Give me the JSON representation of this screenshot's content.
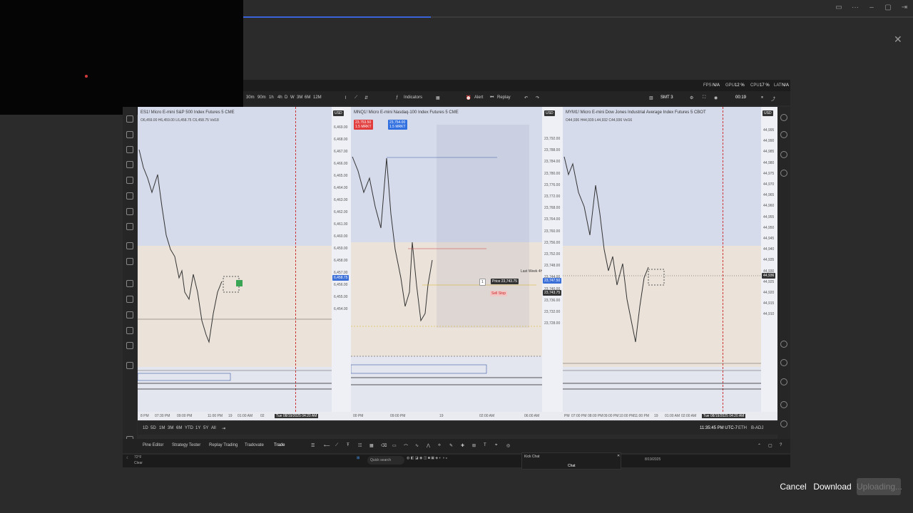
{
  "window": {
    "progress_percent": 28
  },
  "header": {
    "close_icon": "close-icon"
  },
  "status": {
    "fps": "FPS",
    "fps_val": "N/A",
    "gpu": "GPU",
    "gpu_val": "12 %",
    "cpu": "CPU",
    "cpu_val": "17 %",
    "lat": "LAT",
    "lat_val": "N/A"
  },
  "timeframes": [
    "30m",
    "90m",
    "1h",
    "4h",
    "D",
    "W",
    "3M",
    "6M",
    "12M"
  ],
  "toolbar": {
    "indicators": "Indicators",
    "alert": "Alert",
    "replay": "Replay",
    "layout_name": "SMT 3",
    "layout_sub": "Save",
    "timer": "00:19"
  },
  "panes": [
    {
      "title": "ES1!  Micro E-mini S&P 500 Index Futures  5  CME",
      "ohlc": "O6,459.00 H6,459.00 L6,458.75 C6,458.75 Vol18",
      "currency": "USD",
      "ticks": [
        "6,469.00",
        "6,468.00",
        "6,467.00",
        "6,466.00",
        "6,465.00",
        "6,464.00",
        "6,463.00",
        "6,462.00",
        "6,461.00",
        "6,460.00",
        "6,459.00",
        "6,458.00",
        "6,457.00",
        "6,456.00",
        "6,455.00",
        "6,454.00"
      ],
      "last_price": "6,458.75",
      "time_labels": [
        "8 PM",
        "07:30 PM",
        "09:00 PM",
        "11:00 PM",
        "19",
        "01:00 AM",
        "02"
      ],
      "cursor_time": "Tue 08/19/2025  04:20 AM"
    },
    {
      "title": "MNQ1!  Micro E-mini Nasdaq-100 Index Futures  5  CME",
      "ohlc": "",
      "currency": "USD",
      "sell_price": "23,753.50",
      "sell_label": "1.5 MRKT",
      "buy_price": "23,754.00",
      "buy_label": "1.5 MRKT",
      "ticks": [
        "23,792.00",
        "23,788.00",
        "23,784.00",
        "23,780.00",
        "23,776.00",
        "23,772.00",
        "23,768.00",
        "23,764.00",
        "23,760.00",
        "23,756.00",
        "23,752.00",
        "23,748.00",
        "23,744.00",
        "23,740.00",
        "23,736.00",
        "23,732.00",
        "23,728.00"
      ],
      "last_price": "23,747.50",
      "order_price": "Price 23,743.75",
      "order_type": "Sell Stop",
      "order_qty": "1",
      "order_axis": "23,743.75",
      "last_week_label": "Last Week 4H50",
      "time_labels": [
        "00 PM",
        "09:00 PM",
        "19",
        "02:00 AM",
        "06:00 AM"
      ]
    },
    {
      "title": "MYM1!  Micro E-mini Dow Jones Industrial Average Index Futures  5  CBOT",
      "ohlc": "O44,936 H44,939 L44,932 C44,936 Vol16",
      "currency": "USD",
      "ticks": [
        "44,995",
        "44,990",
        "44,985",
        "44,980",
        "44,975",
        "44,970",
        "44,965",
        "44,960",
        "44,955",
        "44,950",
        "44,945",
        "44,940",
        "44,935",
        "44,930",
        "44,925",
        "44,920",
        "44,915",
        "44,910"
      ],
      "last_price": "44,936",
      "time_labels": [
        "PM",
        "07:00 PM",
        "08:00 PM",
        "09:00 PM",
        "10:00 PM",
        "11:00 PM",
        "19",
        "01:00 AM",
        "02:00 AM"
      ],
      "cursor_time": "Tue 08/19/2025  04:20 AM"
    }
  ],
  "ranges": [
    "1D",
    "5D",
    "1M",
    "3M",
    "6M",
    "YTD",
    "1Y",
    "5Y",
    "All"
  ],
  "footer": {
    "clock": "11:35:45 PM UTC-7",
    "session": "ETH",
    "adj": "B-ADJ"
  },
  "bottom_tabs": [
    "Pine Editor",
    "Strategy Tester",
    "Replay Trading",
    "Tradovate",
    "Trade"
  ],
  "taskbar": {
    "weather_temp": "72°F",
    "weather_desc": "Clear",
    "search": "Quick search",
    "date": "8/19/2025"
  },
  "kick_chat": {
    "title": "Kick Chat",
    "tab": "Chat"
  },
  "actions": {
    "cancel": "Cancel",
    "download": "Download",
    "uploading": "Uploading..."
  }
}
